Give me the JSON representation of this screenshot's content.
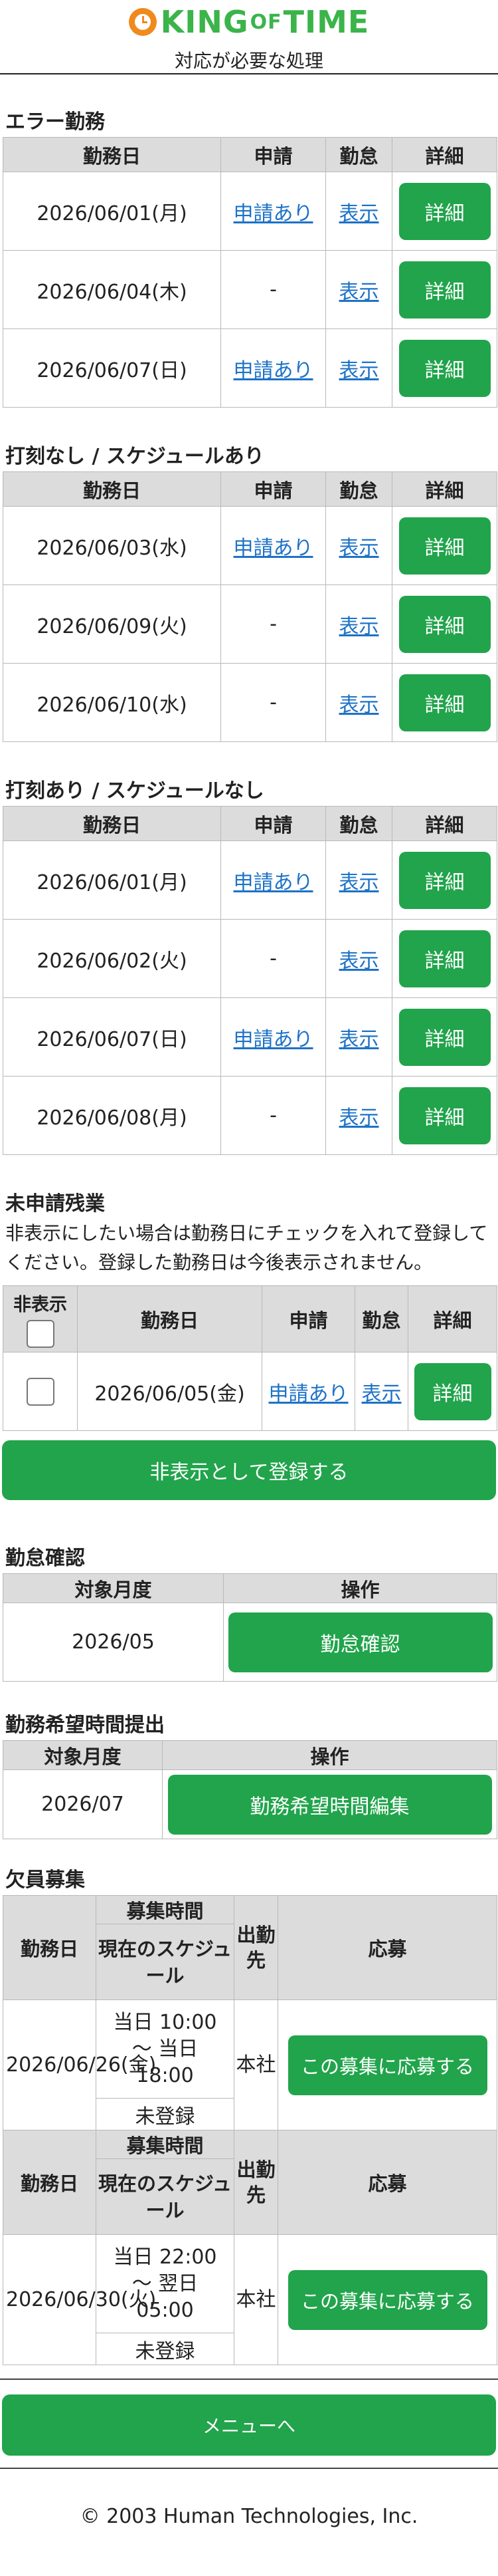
{
  "header": {
    "logo_text_king": "KING",
    "logo_text_of": "OF",
    "logo_text_time": "TIME",
    "subtitle": "対応が必要な処理"
  },
  "columns": {
    "date": "勤務日",
    "request": "申請",
    "attendance": "勤怠",
    "detail": "詳細",
    "hide": "非表示"
  },
  "error_work": {
    "title": "エラー勤務",
    "rows": [
      {
        "date": "2026/06/01(月)",
        "request": "申請あり",
        "attendance": "表示",
        "detail": "詳細"
      },
      {
        "date": "2026/06/04(木)",
        "request": "-",
        "attendance": "表示",
        "detail": "詳細"
      },
      {
        "date": "2026/06/07(日)",
        "request": "申請あり",
        "attendance": "表示",
        "detail": "詳細"
      }
    ]
  },
  "no_punch_schedule": {
    "title": "打刻なし / スケジュールあり",
    "rows": [
      {
        "date": "2026/06/03(水)",
        "request": "申請あり",
        "attendance": "表示",
        "detail": "詳細"
      },
      {
        "date": "2026/06/09(火)",
        "request": "-",
        "attendance": "表示",
        "detail": "詳細"
      },
      {
        "date": "2026/06/10(水)",
        "request": "-",
        "attendance": "表示",
        "detail": "詳細"
      }
    ]
  },
  "punch_no_schedule": {
    "title": "打刻あり / スケジュールなし",
    "rows": [
      {
        "date": "2026/06/01(月)",
        "request": "申請あり",
        "attendance": "表示",
        "detail": "詳細"
      },
      {
        "date": "2026/06/02(火)",
        "request": "-",
        "attendance": "表示",
        "detail": "詳細"
      },
      {
        "date": "2026/06/07(日)",
        "request": "申請あり",
        "attendance": "表示",
        "detail": "詳細"
      },
      {
        "date": "2026/06/08(月)",
        "request": "-",
        "attendance": "表示",
        "detail": "詳細"
      }
    ]
  },
  "unrequested_overtime": {
    "title": "未申請残業",
    "note": "非表示にしたい場合は勤務日にチェックを入れて登録してください。登録した勤務日は今後表示されません。",
    "rows": [
      {
        "date": "2026/06/05(金)",
        "request": "申請あり",
        "attendance": "表示",
        "detail": "詳細"
      }
    ],
    "register_button": "非表示として登録する"
  },
  "attendance_confirm": {
    "title": "勤怠確認",
    "col_month": "対象月度",
    "col_action": "操作",
    "month": "2026/05",
    "button": "勤怠確認"
  },
  "desired_hours": {
    "title": "勤務希望時間提出",
    "col_month": "対象月度",
    "col_action": "操作",
    "month": "2026/07",
    "button": "勤務希望時間編集"
  },
  "vacancy": {
    "title": "欠員募集",
    "col_date": "勤務日",
    "col_recruit_time": "募集時間",
    "col_current_schedule": "現在のスケジュール",
    "col_location": "出勤先",
    "col_apply": "応募",
    "items": [
      {
        "date": "2026/06/26(金)",
        "time": "当日 10:00 ～ 当日 18:00",
        "schedule": "未登録",
        "location": "本社",
        "button": "この募集に応募する"
      },
      {
        "date": "2026/06/30(火)",
        "time": "当日 22:00 ～ 翌日 05:00",
        "schedule": "未登録",
        "location": "本社",
        "button": "この募集に応募する"
      }
    ]
  },
  "menu_button": "メニューへ",
  "footer": "© 2003 Human Technologies, Inc.",
  "colors": {
    "accent_green": "#21a44b",
    "link_blue": "#1d72c7",
    "logo_orange": "#f08a1c"
  }
}
